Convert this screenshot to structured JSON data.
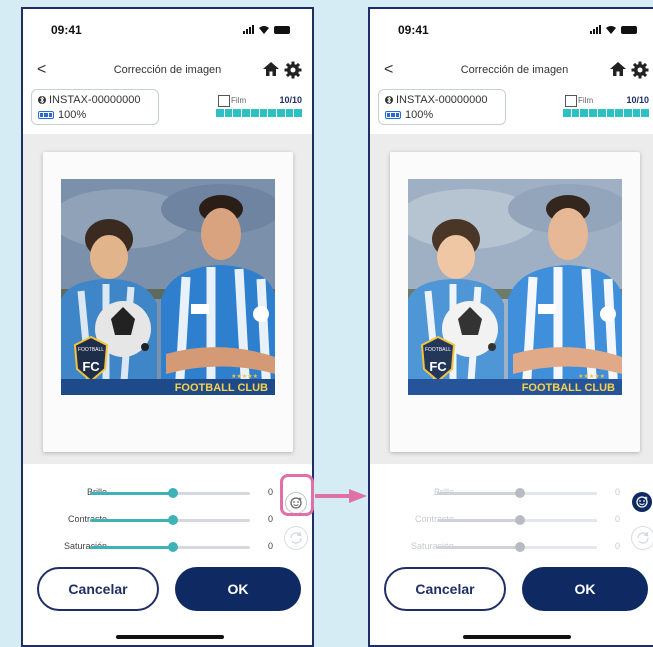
{
  "status": {
    "time": "09:41"
  },
  "header": {
    "title": "Corrección de imagen",
    "back_glyph": "<"
  },
  "device": {
    "name": "INSTAX-00000000",
    "battery": "100%"
  },
  "film": {
    "label": "Film",
    "count": "10/10"
  },
  "photo": {
    "badge_text": "FOOTBALL",
    "badge_letters": "FC",
    "banner": "FOOTBALL CLUB",
    "stars": "★★★★★"
  },
  "sliders": [
    {
      "label": "Brillo",
      "value": "0",
      "level": 0.52
    },
    {
      "label": "Contraste",
      "value": "0",
      "level": 0.52
    },
    {
      "label": "Saturación",
      "value": "0",
      "level": 0.52
    }
  ],
  "buttons": {
    "cancel": "Cancelar",
    "ok": "OK"
  },
  "colors": {
    "page_bg": "#d5ecf4",
    "frame": "#1f2f66",
    "accent": "#3fb2b6",
    "film_bar": "#2ec1c4",
    "ok_bg": "#0f2a63",
    "highlight": "#e070a8"
  },
  "icons": [
    "back-icon",
    "home-icon",
    "gear-icon",
    "bluetooth-icon",
    "battery-icon",
    "signal-icon",
    "wifi-icon",
    "face-enhance-icon",
    "reset-rotate-icon",
    "arrow-right-icon"
  ]
}
